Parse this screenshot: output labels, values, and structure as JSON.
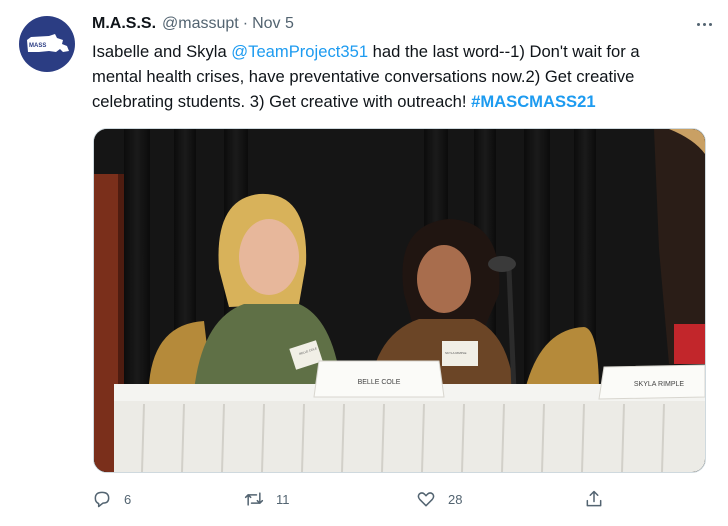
{
  "author": {
    "display_name": "M.A.S.S.",
    "handle": "@massupt",
    "separator": "·",
    "date": "Nov 5",
    "avatar_text": "MASS"
  },
  "tweet": {
    "line1_a": "Isabelle and Skyla ",
    "mention": "@TeamProject351",
    "line1_b": " had the last word--1) Don't wait for a",
    "line2": "mental health crises, have preventative conversations now.2) Get creative",
    "line3_a": "celebrating students. 3) Get creative with outreach! ",
    "hashtag": "#MASCMASS21"
  },
  "media": {
    "name_card_left": "BELLE COLE",
    "name_card_right": "SKYLA RIMPLE",
    "badge_left": "BELLE COLE",
    "badge_right": "SKYLA RIMPLE"
  },
  "actions": {
    "replies": "6",
    "retweets": "11",
    "likes": "28"
  },
  "colors": {
    "link": "#1d9bf0",
    "secondary_text": "#536471",
    "avatar_bg": "#2b3d83"
  }
}
